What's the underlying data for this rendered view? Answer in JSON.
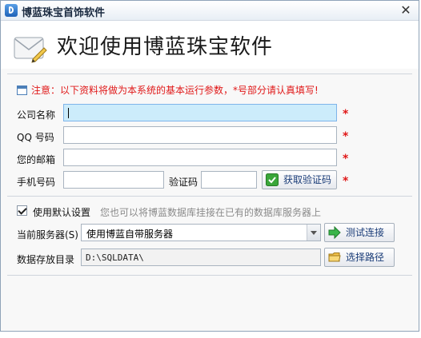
{
  "window": {
    "title": "博蓝珠宝首饰软件",
    "close_glyph": "✕"
  },
  "header": {
    "welcome": "欢迎使用博蓝珠宝软件"
  },
  "notice": {
    "text": "注意：以下资料将做为本系统的基本运行参数，*号部分请认真填写!"
  },
  "form": {
    "company_label": "公司名称",
    "company_value": "",
    "qq_label": "QQ 号码",
    "qq_value": "",
    "email_label": "您的邮箱",
    "email_value": "",
    "phone_label": "手机号码",
    "phone_value": "",
    "code_label": "验证码",
    "code_value": "",
    "get_code_button": "获取验证码",
    "required_mark": "*"
  },
  "settings": {
    "use_default_label": "使用默认设置",
    "use_default_checked": true,
    "hint": "您也可以将博蓝数据库挂接在已有的数据库服务器上",
    "server_label": "当前服务器(S)",
    "server_value": "使用博蓝自带服务器",
    "test_button": "测试连接",
    "dir_label": "数据存放目录",
    "dir_value": "D:\\SQLDATA\\",
    "choose_path_button": "选择路径"
  },
  "colors": {
    "accent_red": "#e01818",
    "focus_bg": "#ccecfb",
    "link_blue": "#1a3c78"
  }
}
